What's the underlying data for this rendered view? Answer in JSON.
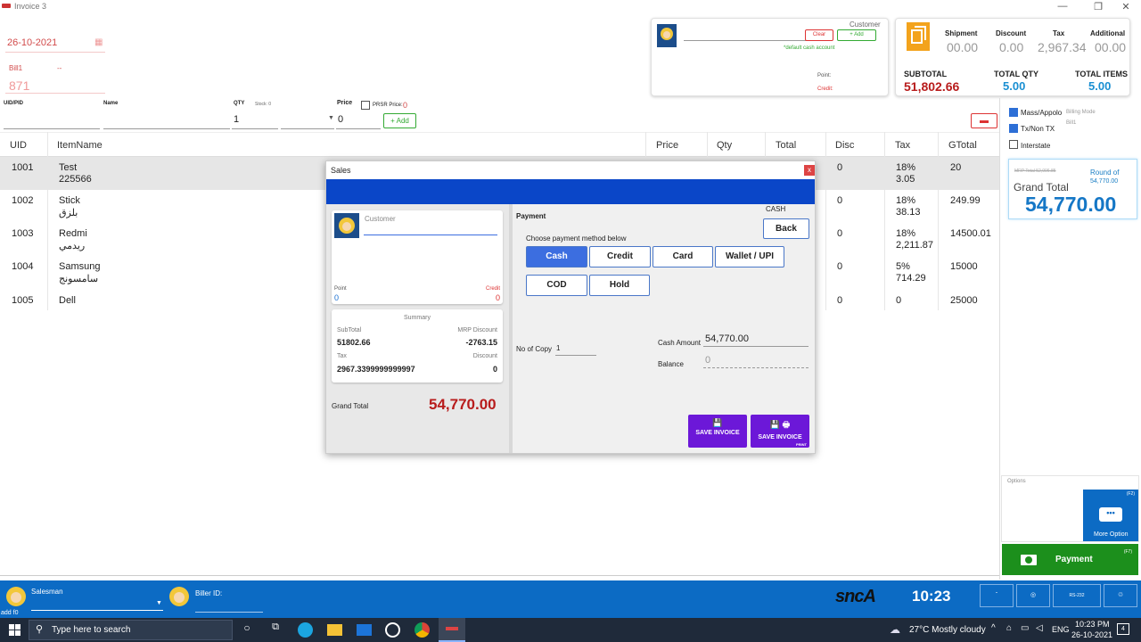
{
  "window": {
    "title": "Invoice 3",
    "minimize": "—",
    "maximize": "❐",
    "close": "✕"
  },
  "header": {
    "date": "26-10-2021",
    "bill_label": "Bill1",
    "bill_dash": "--",
    "bill_no": "871"
  },
  "customer_card": {
    "label": "Customer",
    "clear": "Clear",
    "add": "+ Add",
    "default_text": "*default cash account",
    "point_label": "Point:",
    "credit_label": "Credit:"
  },
  "totals_card": {
    "shipment_label": "Shipment",
    "shipment": "00.00",
    "discount_label": "Discount",
    "discount": "0.00",
    "tax_label": "Tax",
    "tax": "2,967.34",
    "additional_label": "Additional",
    "additional": "00.00",
    "subtotal_label": "SUBTOTAL",
    "subtotal": "51,802.66",
    "qty_label": "TOTAL QTY",
    "qty": "5.00",
    "items_label": "TOTAL ITEMS",
    "items": "5.00"
  },
  "entry": {
    "uid_label": "UID/PID",
    "name_label": "Name",
    "qty_label": "QTY",
    "stock_label": "Stock: 0",
    "qty_value": "1",
    "price_label": "Price",
    "price_value": "0",
    "prsr_label": "PRSR Price:",
    "prsr_value": "0",
    "add_label": "+ Add"
  },
  "table": {
    "headers": {
      "uid": "UID",
      "item": "ItemName",
      "price": "Price",
      "qty": "Qty",
      "total": "Total",
      "disc": "Disc",
      "tax": "Tax",
      "gtotal": "GTotal"
    },
    "rows": [
      {
        "uid": "1001",
        "name": "Test",
        "sub": "225566",
        "disc": "0",
        "tax": "18%",
        "tax2": "3.05",
        "gtotal": "20"
      },
      {
        "uid": "1002",
        "name": "Stick",
        "sub": "بلزق",
        "disc": "0",
        "tax": "18%",
        "tax2": "38.13",
        "gtotal": "249.99"
      },
      {
        "uid": "1003",
        "name": "Redmi",
        "sub": "ريدمي",
        "disc": "0",
        "tax": "18%",
        "tax2": "2,211.87",
        "gtotal": "14500.01"
      },
      {
        "uid": "1004",
        "name": "Samsung",
        "sub": "سامسونج",
        "disc": "0",
        "tax": "5%",
        "tax2": "714.29",
        "gtotal": "15000"
      },
      {
        "uid": "1005",
        "name": "Dell",
        "sub": "",
        "disc": "0",
        "tax": "0",
        "tax2": "",
        "gtotal": "25000"
      }
    ]
  },
  "right_panel": {
    "mass_label": "Mass/Appolo",
    "billing_mode": "Billing Mode",
    "bill1": "Bill1",
    "tx_label": "Tx/Non TX",
    "interstate_label": "Interstate",
    "mrp_total": "MRP Total 52,006.85",
    "round_of": "Round of",
    "round_value": "54,770.00",
    "grand_label": "Grand Total",
    "grand_value": "54,770.00",
    "options_label": "Options",
    "more_option": "More Option",
    "f2": "(F2)",
    "payment": "Payment",
    "f7": "(F7)"
  },
  "dialog": {
    "title": "Sales",
    "close": "x",
    "customer_placeholder": "Customer",
    "point_label": "Point",
    "point_value": "0",
    "credit_label": "Credit",
    "credit_value": "0",
    "summary_label": "Summary",
    "subtotal_label": "SubTotal",
    "subtotal": "51802.66",
    "mrp_disc_label": "MRP Discount",
    "mrp_disc": "-2763.15",
    "tax_label": "Tax",
    "tax": "2967.3399999999997",
    "disc_label": "Discount",
    "disc": "0",
    "grand_label": "Grand Total",
    "grand": "54,770.00",
    "payment_label": "Payment",
    "mode": "CASH",
    "back": "Back",
    "choose": "Choose payment method below",
    "methods": [
      "Cash",
      "Credit",
      "Card",
      "Wallet / UPI",
      "COD",
      "Hold"
    ],
    "copies_label": "No of Copy",
    "copies": "1",
    "cash_label": "Cash Amount",
    "cash": "54,770.00",
    "balance_label": "Balance",
    "balance": "0",
    "save1": "SAVE INVOICE",
    "save2": "SAVE INVOICE",
    "print": "PRINT"
  },
  "bottom": {
    "salesman_label": "Salesman",
    "add_f0": "add f0",
    "biller_label": "Biller ID:",
    "logo": "sncA",
    "clock": "10:23",
    "rs232": "RS-232"
  },
  "taskbar": {
    "search": "Type here to search",
    "weather": "27°C  Mostly cloudy",
    "lang": "ENG",
    "time": "10:23 PM",
    "date": "26-10-2021",
    "notif": "4"
  },
  "colors": {
    "accent": "#3c6ee0",
    "blue_bar": "#0a46c8",
    "bottom_bar": "#0c6bc4",
    "green": "#1c8f1c",
    "red": "#b81c1c",
    "purple": "#6c18d8"
  }
}
